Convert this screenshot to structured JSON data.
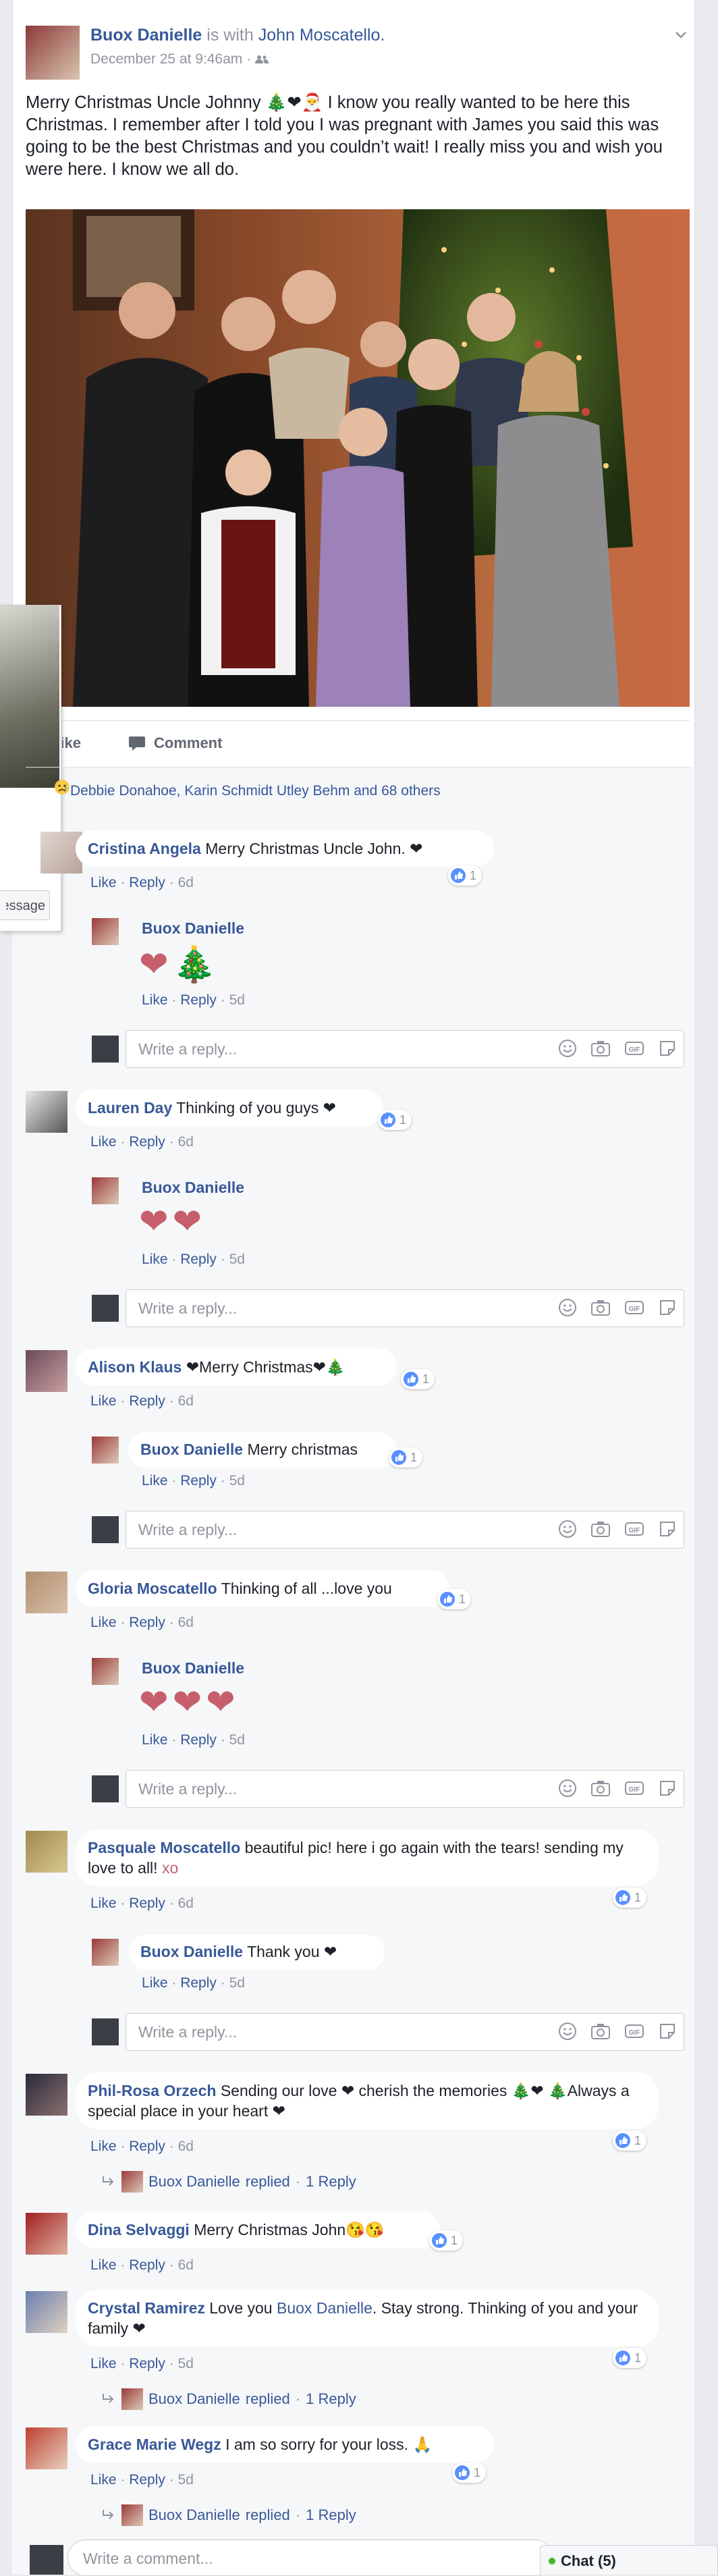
{
  "post": {
    "author": "Buox Danielle",
    "with_word": "is with",
    "with_name": "John Moscatello.",
    "date": "December 25 at 9:46am",
    "privacy_sep": "·",
    "text": "Merry Christmas Uncle Johnny 🎄❤🎅 I know you really wanted to be here this Christmas. I remember after I told you I was pregnant with James you said this was going to be the best Christmas and you couldn’t wait! I really miss you and wish you were here. I know we all do."
  },
  "actions": {
    "like": "Like",
    "comment": "Comment"
  },
  "popup": {
    "message_btn": "Message"
  },
  "reactions": {
    "text": "Debbie Donahoe, Karin Schmidt Utley Behm and 68 others"
  },
  "comments": [
    {
      "name": "Cristina Angela",
      "text": "Merry Christmas Uncle John. ❤",
      "like": "Like",
      "reply": "Reply",
      "age": "6d",
      "likes": "1",
      "reply_items": [
        {
          "name": "Buox Danielle",
          "emoji": "❤🎄",
          "like": "Like",
          "reply": "Reply",
          "age": "5d"
        }
      ]
    },
    {
      "name": "Lauren Day",
      "text": "Thinking of you guys ❤",
      "like": "Like",
      "reply": "Reply",
      "age": "6d",
      "likes": "1",
      "reply_items": [
        {
          "name": "Buox Danielle",
          "emoji": "❤❤",
          "like": "Like",
          "reply": "Reply",
          "age": "5d"
        }
      ]
    },
    {
      "name": "Alison Klaus",
      "text": "❤Merry Christmas❤🎄",
      "like": "Like",
      "reply": "Reply",
      "age": "6d",
      "likes": "1",
      "reply_items": [
        {
          "name": "Buox Danielle",
          "text": "Merry christmas",
          "like": "Like",
          "reply": "Reply",
          "age": "5d",
          "likes": "1"
        }
      ]
    },
    {
      "name": "Gloria Moscatello",
      "text": "Thinking of all ...love you",
      "like": "Like",
      "reply": "Reply",
      "age": "6d",
      "likes": "1",
      "reply_items": [
        {
          "name": "Buox Danielle",
          "emoji": "❤❤❤",
          "like": "Like",
          "reply": "Reply",
          "age": "5d"
        }
      ]
    },
    {
      "name": "Pasquale Moscatello",
      "text": "beautiful pic! here i go again with the tears! sending my love to all!",
      "xo": "xo",
      "like": "Like",
      "reply": "Reply",
      "age": "6d",
      "likes": "1",
      "reply_items": [
        {
          "name": "Buox Danielle",
          "text": "Thank you ❤",
          "like": "Like",
          "reply": "Reply",
          "age": "5d"
        }
      ]
    },
    {
      "name": "Phil-Rosa Orzech",
      "text": "Sending our love ❤ cherish the memories 🎄❤ 🎄Always a special place in your heart ❤",
      "like": "Like",
      "reply": "Reply",
      "age": "6d",
      "likes": "1",
      "replied": {
        "name": "Buox Danielle",
        "verb": "replied",
        "count": "1 Reply"
      }
    },
    {
      "name": "Dina Selvaggi",
      "text": "Merry Christmas John😘😘",
      "like": "Like",
      "reply": "Reply",
      "age": "6d",
      "likes": "1"
    },
    {
      "name": "Crystal Ramirez",
      "text_a": "Love you",
      "mention": "Buox Danielle",
      "text_b": ". Stay strong. Thinking of you and your family ❤",
      "like": "Like",
      "reply": "Reply",
      "age": "5d",
      "likes": "1",
      "replied": {
        "name": "Buox Danielle",
        "verb": "replied",
        "count": "1 Reply"
      }
    },
    {
      "name": "Grace Marie Wegz",
      "text": "I am so sorry for your loss. 🙏",
      "like": "Like",
      "reply": "Reply",
      "age": "5d",
      "likes": "1",
      "replied": {
        "name": "Buox Danielle",
        "verb": "replied",
        "count": "1 Reply"
      }
    }
  ],
  "reply_placeholder": "Write a reply...",
  "comment_placeholder": "Write a comment...",
  "chat": {
    "label": "Chat (5)"
  },
  "colors": {
    "link": "#385898",
    "meta": "#90949c",
    "like_blue": "#5890ff",
    "heart": "#c65f6b"
  }
}
